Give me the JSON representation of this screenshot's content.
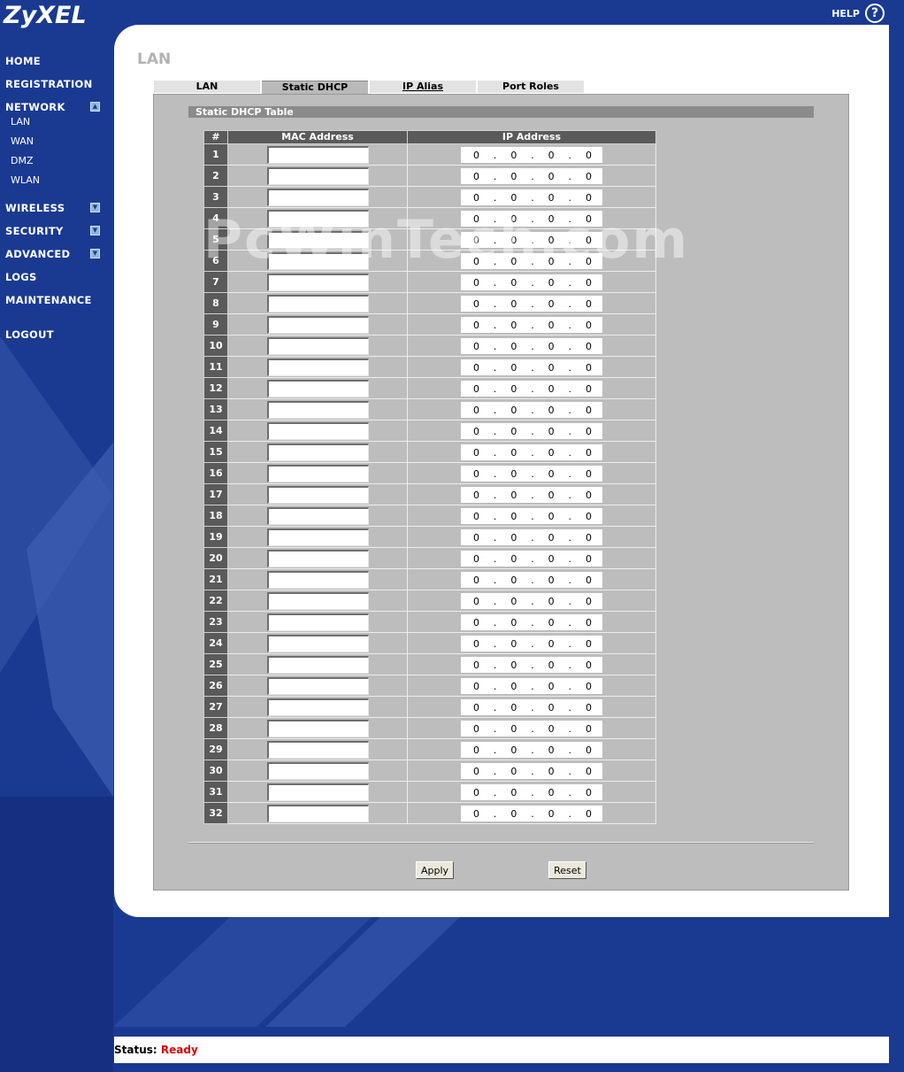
{
  "app": {
    "logo": "ZyXEL",
    "help_label": "HELP"
  },
  "sidebar": {
    "home": "HOME",
    "registration": "REGISTRATION",
    "network": "NETWORK",
    "network_sub": [
      "LAN",
      "WAN",
      "DMZ",
      "WLAN"
    ],
    "wireless": "WIRELESS",
    "security": "SECURITY",
    "advanced": "ADVANCED",
    "logs": "LOGS",
    "maintenance": "MAINTENANCE",
    "logout": "LOGOUT"
  },
  "page": {
    "title": "LAN",
    "tabs": [
      {
        "label": "LAN",
        "active": false
      },
      {
        "label": "Static DHCP",
        "active": true
      },
      {
        "label": "IP Alias",
        "active": false
      },
      {
        "label": "Port Roles",
        "active": false
      }
    ],
    "section_title": "Static DHCP Table",
    "columns": [
      "#",
      "MAC Address",
      "IP Address"
    ],
    "rows": [
      {
        "num": "1",
        "mac": "",
        "ip": [
          "0",
          "0",
          "0",
          "0"
        ]
      },
      {
        "num": "2",
        "mac": "",
        "ip": [
          "0",
          "0",
          "0",
          "0"
        ]
      },
      {
        "num": "3",
        "mac": "",
        "ip": [
          "0",
          "0",
          "0",
          "0"
        ]
      },
      {
        "num": "4",
        "mac": "",
        "ip": [
          "0",
          "0",
          "0",
          "0"
        ]
      },
      {
        "num": "5",
        "mac": "",
        "ip": [
          "0",
          "0",
          "0",
          "0"
        ]
      },
      {
        "num": "6",
        "mac": "",
        "ip": [
          "0",
          "0",
          "0",
          "0"
        ]
      },
      {
        "num": "7",
        "mac": "",
        "ip": [
          "0",
          "0",
          "0",
          "0"
        ]
      },
      {
        "num": "8",
        "mac": "",
        "ip": [
          "0",
          "0",
          "0",
          "0"
        ]
      },
      {
        "num": "9",
        "mac": "",
        "ip": [
          "0",
          "0",
          "0",
          "0"
        ]
      },
      {
        "num": "10",
        "mac": "",
        "ip": [
          "0",
          "0",
          "0",
          "0"
        ]
      },
      {
        "num": "11",
        "mac": "",
        "ip": [
          "0",
          "0",
          "0",
          "0"
        ]
      },
      {
        "num": "12",
        "mac": "",
        "ip": [
          "0",
          "0",
          "0",
          "0"
        ]
      },
      {
        "num": "13",
        "mac": "",
        "ip": [
          "0",
          "0",
          "0",
          "0"
        ]
      },
      {
        "num": "14",
        "mac": "",
        "ip": [
          "0",
          "0",
          "0",
          "0"
        ]
      },
      {
        "num": "15",
        "mac": "",
        "ip": [
          "0",
          "0",
          "0",
          "0"
        ]
      },
      {
        "num": "16",
        "mac": "",
        "ip": [
          "0",
          "0",
          "0",
          "0"
        ]
      },
      {
        "num": "17",
        "mac": "",
        "ip": [
          "0",
          "0",
          "0",
          "0"
        ]
      },
      {
        "num": "18",
        "mac": "",
        "ip": [
          "0",
          "0",
          "0",
          "0"
        ]
      },
      {
        "num": "19",
        "mac": "",
        "ip": [
          "0",
          "0",
          "0",
          "0"
        ]
      },
      {
        "num": "20",
        "mac": "",
        "ip": [
          "0",
          "0",
          "0",
          "0"
        ]
      },
      {
        "num": "21",
        "mac": "",
        "ip": [
          "0",
          "0",
          "0",
          "0"
        ]
      },
      {
        "num": "22",
        "mac": "",
        "ip": [
          "0",
          "0",
          "0",
          "0"
        ]
      },
      {
        "num": "23",
        "mac": "",
        "ip": [
          "0",
          "0",
          "0",
          "0"
        ]
      },
      {
        "num": "24",
        "mac": "",
        "ip": [
          "0",
          "0",
          "0",
          "0"
        ]
      },
      {
        "num": "25",
        "mac": "",
        "ip": [
          "0",
          "0",
          "0",
          "0"
        ]
      },
      {
        "num": "26",
        "mac": "",
        "ip": [
          "0",
          "0",
          "0",
          "0"
        ]
      },
      {
        "num": "27",
        "mac": "",
        "ip": [
          "0",
          "0",
          "0",
          "0"
        ]
      },
      {
        "num": "28",
        "mac": "",
        "ip": [
          "0",
          "0",
          "0",
          "0"
        ]
      },
      {
        "num": "29",
        "mac": "",
        "ip": [
          "0",
          "0",
          "0",
          "0"
        ]
      },
      {
        "num": "30",
        "mac": "",
        "ip": [
          "0",
          "0",
          "0",
          "0"
        ]
      },
      {
        "num": "31",
        "mac": "",
        "ip": [
          "0",
          "0",
          "0",
          "0"
        ]
      },
      {
        "num": "32",
        "mac": "",
        "ip": [
          "0",
          "0",
          "0",
          "0"
        ]
      }
    ],
    "apply_label": "Apply",
    "reset_label": "Reset",
    "watermark": "PcWinTech.com"
  },
  "status": {
    "label": "Status:",
    "value": "Ready"
  },
  "colors": {
    "background": "#1a3a92",
    "header_cell": "#5a5a5a",
    "content_gray": "#bdbdbd",
    "status_ready": "#dd0000"
  }
}
